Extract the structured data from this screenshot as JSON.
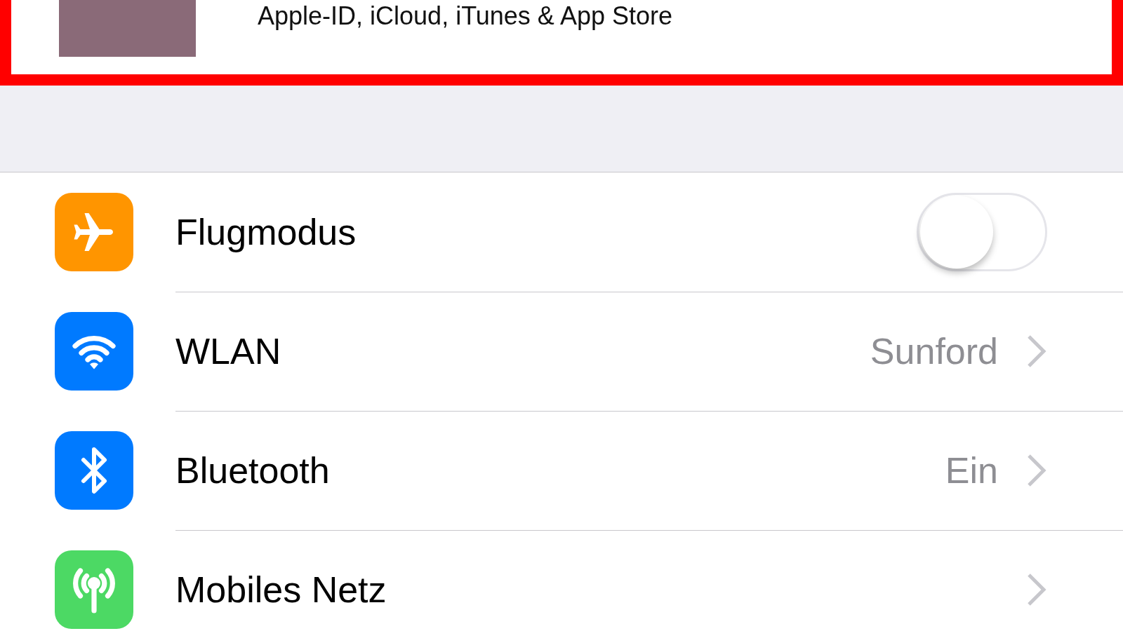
{
  "account": {
    "subtitle": "Apple-ID, iCloud, iTunes & App Store",
    "highlighted": true
  },
  "settings": [
    {
      "kind": "toggle",
      "color": "#ff9500",
      "label": "Flugmodus",
      "on": false
    },
    {
      "kind": "link",
      "color": "#007aff",
      "label": "WLAN",
      "value": "Sunford"
    },
    {
      "kind": "link",
      "color": "#007aff",
      "label": "Bluetooth",
      "value": "Ein"
    },
    {
      "kind": "link",
      "color": "#4cd964",
      "label": "Mobiles Netz"
    }
  ]
}
